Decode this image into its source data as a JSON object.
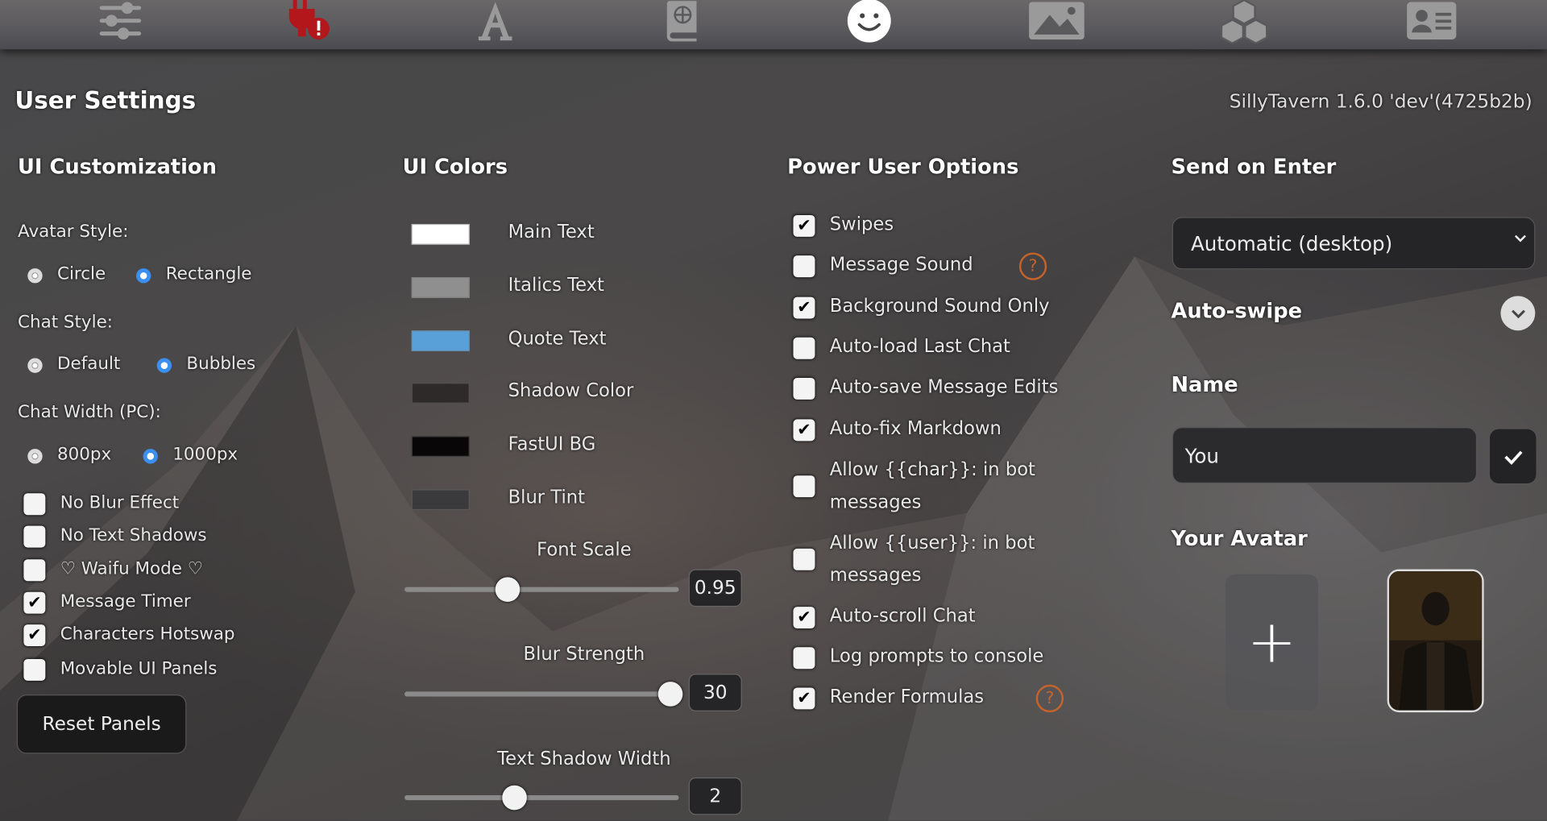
{
  "topbar": {
    "icons": [
      {
        "name": "sliders-icon",
        "color": "#9a9a9a",
        "active": false
      },
      {
        "name": "plug-warning-icon",
        "color": "#b3161b",
        "active": false
      },
      {
        "name": "font-icon",
        "color": "#9a9a9a",
        "active": false
      },
      {
        "name": "book-atlas-icon",
        "color": "#9a9a9a",
        "active": false
      },
      {
        "name": "smiley-face-icon",
        "color": "#ffffff",
        "active": true
      },
      {
        "name": "image-icon",
        "color": "#9a9a9a",
        "active": false
      },
      {
        "name": "cubes-icon",
        "color": "#9a9a9a",
        "active": false
      },
      {
        "name": "address-card-icon",
        "color": "#9a9a9a",
        "active": false
      }
    ]
  },
  "header": {
    "title": "User Settings",
    "version": "SillyTavern 1.6.0 'dev'(4725b2b)"
  },
  "ui_customization": {
    "heading": "UI Customization",
    "avatar_style": {
      "label": "Avatar Style:",
      "options": [
        "Circle",
        "Rectangle"
      ],
      "selected": "Rectangle"
    },
    "chat_style": {
      "label": "Chat Style:",
      "options": [
        "Default",
        "Bubbles"
      ],
      "selected": "Bubbles"
    },
    "chat_width": {
      "label": "Chat Width (PC):",
      "options": [
        "800px",
        "1000px"
      ],
      "selected": "1000px"
    },
    "checkboxes": [
      {
        "label": "No Blur Effect",
        "checked": false
      },
      {
        "label": "No Text Shadows",
        "checked": false
      },
      {
        "label": "♡ Waifu Mode ♡",
        "checked": false
      },
      {
        "label": "Message Timer",
        "checked": true
      },
      {
        "label": "Characters Hotswap",
        "checked": true
      },
      {
        "label": "Movable UI Panels",
        "checked": false
      }
    ],
    "reset_button": "Reset Panels"
  },
  "ui_colors": {
    "heading": "UI Colors",
    "colors": [
      {
        "label": "Main Text",
        "color": "#ffffff"
      },
      {
        "label": "Italics Text",
        "color": "#8f8f8f"
      },
      {
        "label": "Quote Text",
        "color": "#5aa0d8"
      },
      {
        "label": "Shadow Color",
        "color": "#2e2a2a"
      },
      {
        "label": "FastUI BG",
        "color": "#080606"
      },
      {
        "label": "Blur Tint",
        "color": "#3a3a3c"
      }
    ],
    "sliders": [
      {
        "label": "Font Scale",
        "value": "0.95",
        "min": 0.8,
        "max": 1.2
      },
      {
        "label": "Blur Strength",
        "value": "30",
        "min": 0,
        "max": 31
      },
      {
        "label": "Text Shadow Width",
        "value": "2",
        "min": 0,
        "max": 5
      }
    ]
  },
  "power_user": {
    "heading": "Power User Options",
    "options": [
      {
        "label": "Swipes",
        "checked": true
      },
      {
        "label": "Message Sound",
        "checked": false,
        "help": "?"
      },
      {
        "label": "Background Sound Only",
        "checked": true
      },
      {
        "label": "Auto-load Last Chat",
        "checked": false
      },
      {
        "label": "Auto-save Message Edits",
        "checked": false
      },
      {
        "label": "Auto-fix Markdown",
        "checked": true
      },
      {
        "label": "Allow {{char}}: in bot",
        "label2": "messages",
        "checked": false
      },
      {
        "label": "Allow {{user}}: in bot",
        "label2": "messages",
        "checked": false
      },
      {
        "label": "Auto-scroll Chat",
        "checked": true
      },
      {
        "label": "Log prompts to console",
        "checked": false
      },
      {
        "label": "Render Formulas",
        "checked": true,
        "help": "?"
      }
    ]
  },
  "right": {
    "send_on_enter": {
      "heading": "Send on Enter",
      "selected": "Automatic (desktop)"
    },
    "auto_swipe": {
      "heading": "Auto-swipe"
    },
    "name": {
      "heading": "Name",
      "value": "You"
    },
    "avatar": {
      "heading": "Your Avatar",
      "add": "+"
    }
  }
}
